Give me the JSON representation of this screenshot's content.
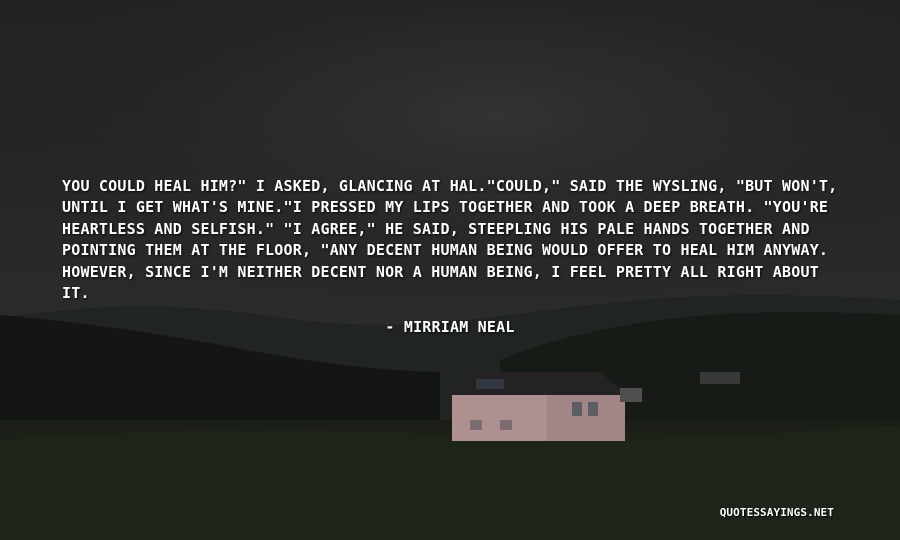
{
  "quote": {
    "text": "You could heal him?\" I asked, glancing at Hal.\"Could,\" said the wysling, \"but won't, until I get what's mine.\"I pressed my lips together and took a deep breath. \"You're heartless and selfish.\" \"I agree,\" he said, steepling his pale hands together and pointing them at the floor, \"any decent human being would offer to heal him anyway. However, since I'm neither decent nor a human being, I feel pretty all right about it.",
    "author": "- Mirriam Neal"
  },
  "watermark": "QUOTESSAYINGS.NET",
  "colors": {
    "text": "#ffffff",
    "sky": "#2b2c2d",
    "hills": "#1c1f1b",
    "grass": "#22291f",
    "house_walls": "#c7a4a6",
    "roof": "#2a2727"
  }
}
